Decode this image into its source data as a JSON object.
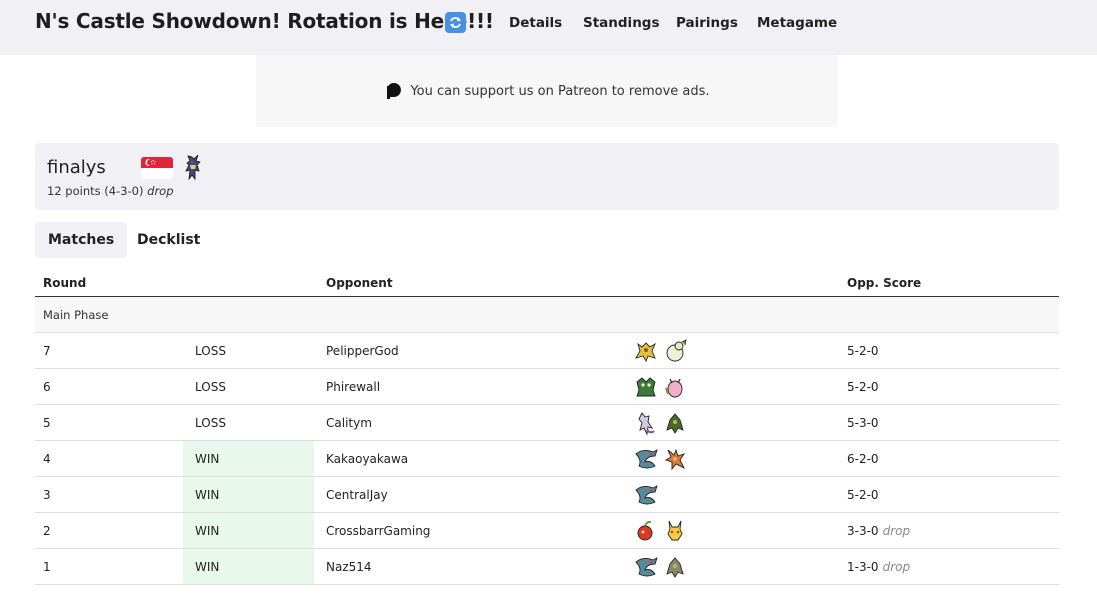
{
  "header": {
    "title": "N's Castle Showdown! Rotation is Here!!!",
    "nav": [
      "Details",
      "Standings",
      "Pairings",
      "Metagame"
    ],
    "refresh_icon": "refresh-icon"
  },
  "ad": {
    "text": "You can support us on Patreon to remove ads.",
    "icon": "patreon-icon"
  },
  "player": {
    "name": "finalys",
    "country_flag": "singapore-flag",
    "summary": "12 points (4-3-0)",
    "status": "drop",
    "deck_icon": "lucario-sprite-icon"
  },
  "tabs": [
    {
      "label": "Matches",
      "active": true
    },
    {
      "label": "Decklist",
      "active": false
    }
  ],
  "table": {
    "headers": {
      "round": "Round",
      "opponent": "Opponent",
      "opp_score": "Opp. Score"
    },
    "phase": "Main Phase",
    "rows": [
      {
        "round": "7",
        "result": "LOSS",
        "opponent": "PelipperGod",
        "score": "5-2-0",
        "drop": "",
        "sprites": [
          "alakazam-sprite-icon",
          "smeargle-sprite-icon"
        ]
      },
      {
        "round": "6",
        "result": "LOSS",
        "opponent": "Phirewall",
        "score": "5-2-0",
        "drop": "",
        "sprites": [
          "decidueye-sprite-icon",
          "clefable-sprite-icon"
        ]
      },
      {
        "round": "5",
        "result": "LOSS",
        "opponent": "Calitym",
        "score": "5-3-0",
        "drop": "",
        "sprites": [
          "mewtwo-sprite-icon",
          "kartana-sprite-icon"
        ]
      },
      {
        "round": "4",
        "result": "WIN",
        "opponent": "Kakaoyakawa",
        "score": "6-2-0",
        "drop": "",
        "sprites": [
          "dragapult-sprite-icon",
          "ho-oh-sprite-icon"
        ]
      },
      {
        "round": "3",
        "result": "WIN",
        "opponent": "CentralJay",
        "score": "5-2-0",
        "drop": "",
        "sprites": [
          "dragapult-sprite-icon"
        ]
      },
      {
        "round": "2",
        "result": "WIN",
        "opponent": "CrossbarrGaming",
        "score": "3-3-0",
        "drop": "drop",
        "sprites": [
          "applin-sprite-icon",
          "pikachu-sprite-icon"
        ]
      },
      {
        "round": "1",
        "result": "WIN",
        "opponent": "Naz514",
        "score": "1-3-0",
        "drop": "drop",
        "sprites": [
          "dragapult-sprite-icon",
          "kartana-sprite-icon"
        ]
      }
    ]
  },
  "colors": {
    "win_bg": "#e8f8ec",
    "header_bg": "#f1f1f5",
    "accent": "#4a90e2"
  }
}
